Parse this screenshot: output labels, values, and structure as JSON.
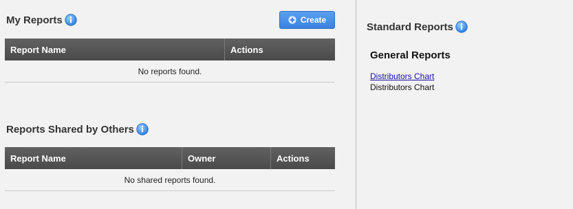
{
  "my_reports": {
    "title": "My Reports",
    "create_label": "Create",
    "columns": [
      "Report Name",
      "Actions"
    ],
    "empty_text": "No reports found."
  },
  "shared_reports": {
    "title": "Reports Shared by Others",
    "columns": [
      "Report Name",
      "Owner",
      "Actions"
    ],
    "empty_text": "No shared reports found."
  },
  "standard_reports": {
    "title": "Standard Reports",
    "group_title": "General Reports",
    "items": [
      {
        "link": "Distributors Chart",
        "description": "Distributors Chart"
      }
    ]
  },
  "colors": {
    "accent": "#3a82df",
    "header_bg": "#555555",
    "link": "#1a0dab"
  }
}
